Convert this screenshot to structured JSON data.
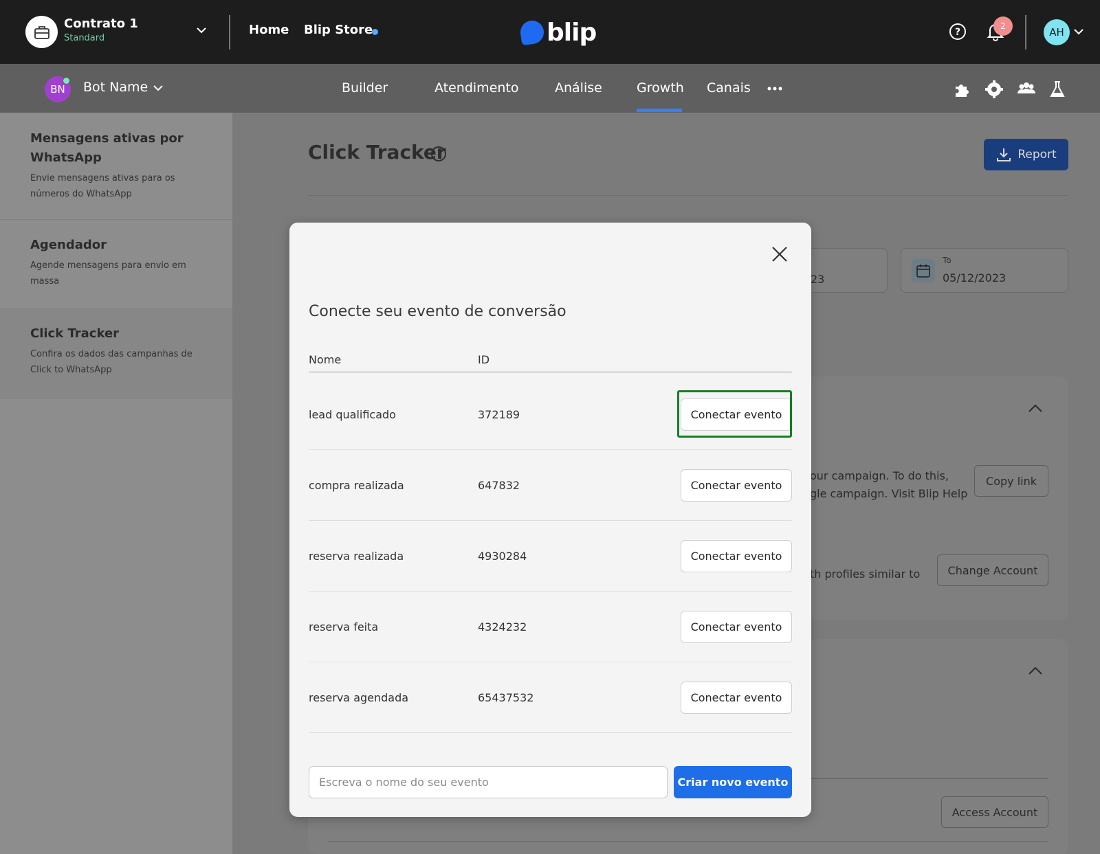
{
  "topbar": {
    "contract_title": "Contrato 1",
    "contract_plan": "Standard",
    "nav_home": "Home",
    "nav_store": "Blip Store",
    "logo_text": "blip",
    "notification_count": "2",
    "user_initials": "AH"
  },
  "subbar": {
    "bot_initials": "BN",
    "bot_name": "Bot Name",
    "tabs": [
      {
        "label": "Builder"
      },
      {
        "label": "Atendimento"
      },
      {
        "label": "Análise"
      },
      {
        "label": "Growth",
        "active": true
      },
      {
        "label": "Canais"
      }
    ]
  },
  "sidebar": {
    "items": [
      {
        "title": "Mensagens ativas por WhatsApp",
        "desc": "Envie mensagens ativas para os números do WhatsApp"
      },
      {
        "title": "Agendador",
        "desc": "Agende mensagens para envio em massa"
      },
      {
        "title": "Click Tracker",
        "desc": "Confira os dados das campanhas de Click to WhatsApp",
        "active": true
      }
    ]
  },
  "main": {
    "title": "Click Tracker",
    "report_label": "Report",
    "from_value_partial": "23",
    "to_label": "To",
    "to_value": "05/12/2023",
    "card1_text_line1": "our campaign. To do this,",
    "card1_text_line2": "gle campaign. Visit Blip Help",
    "copy_link_label": "Copy link",
    "card1_text_line3": "th profiles similar to",
    "change_account_label": "Change Account",
    "access_account_label": "Access Account"
  },
  "modal": {
    "title": "Conecte seu evento de conversão",
    "col_name": "Nome",
    "col_id": "ID",
    "rows": [
      {
        "name": "lead qualificado",
        "id": "372189",
        "button": "Conectar evento"
      },
      {
        "name": "compra realizada",
        "id": "647832",
        "button": "Conectar evento"
      },
      {
        "name": "reserva realizada",
        "id": "4930284",
        "button": "Conectar evento"
      },
      {
        "name": "reserva feita",
        "id": "4324232",
        "button": "Conectar evento"
      },
      {
        "name": "reserva agendada",
        "id": "65437532",
        "button": "Conectar evento"
      }
    ],
    "input_placeholder": "Escreva o nome do seu evento",
    "create_label": "Criar novo evento"
  },
  "colors": {
    "accent": "#1d6ee8",
    "highlight": "#127f22",
    "topbar": "#1d1d1d"
  }
}
